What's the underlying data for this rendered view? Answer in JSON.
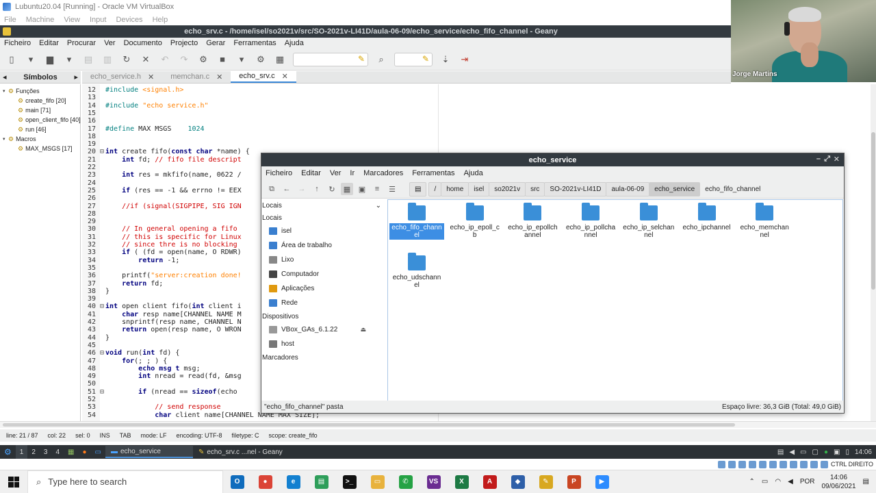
{
  "vbox": {
    "title": "Lubuntu20.04 [Running] - Oracle VM VirtualBox",
    "menu": [
      "File",
      "Machine",
      "View",
      "Input",
      "Devices",
      "Help"
    ]
  },
  "geany": {
    "title": "echo_srv.c - /home/isel/so2021v/src/SO-2021v-LI41D/aula-06-09/echo_service/echo_fifo_channel - Geany",
    "menu": [
      "Ficheiro",
      "Editar",
      "Procurar",
      "Ver",
      "Documento",
      "Projecto",
      "Gerar",
      "Ferramentas",
      "Ajuda"
    ],
    "sidebar_tab": "Símbolos",
    "symbols": [
      {
        "label": "Funções",
        "level": 0,
        "icon": "folder-icon"
      },
      {
        "label": "create_fifo [20]",
        "level": 1,
        "icon": "function-icon"
      },
      {
        "label": "main [71]",
        "level": 1,
        "icon": "function-icon"
      },
      {
        "label": "open_client_fifo [40]",
        "level": 1,
        "icon": "function-icon"
      },
      {
        "label": "run [46]",
        "level": 1,
        "icon": "function-icon"
      },
      {
        "label": "Macros",
        "level": 0,
        "icon": "folder-icon"
      },
      {
        "label": "MAX_MSGS [17]",
        "level": 1,
        "icon": "macro-icon"
      }
    ],
    "tabs": [
      {
        "label": "echo_service.h",
        "active": false
      },
      {
        "label": "memchan.c",
        "active": false
      },
      {
        "label": "echo_srv.c",
        "active": true
      }
    ],
    "status": {
      "line": "line: 21 / 87",
      "col": "col: 22",
      "sel": "sel: 0",
      "ins": "INS",
      "tab": "TAB",
      "mode": "mode: LF",
      "encoding": "encoding: UTF-8",
      "filetype": "filetype: C",
      "scope": "scope: create_fifo"
    }
  },
  "code_lines": [
    {
      "n": "12",
      "fold": "",
      "html": "<span class='pp'>#include </span><span class='str'>&lt;signal.h&gt;</span>"
    },
    {
      "n": "13",
      "fold": "",
      "html": ""
    },
    {
      "n": "14",
      "fold": "",
      "html": "<span class='pp'>#include </span><span class='str'>\"echo service.h\"</span>"
    },
    {
      "n": "15",
      "fold": "",
      "html": ""
    },
    {
      "n": "16",
      "fold": "",
      "html": ""
    },
    {
      "n": "17",
      "fold": "",
      "html": "<span class='pp'>#define</span> MAX MSGS    <span class='pp'>1024</span>"
    },
    {
      "n": "18",
      "fold": "",
      "html": ""
    },
    {
      "n": "19",
      "fold": "",
      "html": ""
    },
    {
      "n": "20",
      "fold": "⊟",
      "html": "<span class='kw'>int</span> create fifo(<span class='kw'>const char</span> *name) {"
    },
    {
      "n": "21",
      "fold": "",
      "html": "    <span class='kw'>int</span> fd; <span class='cm'>// fifo file descript</span>"
    },
    {
      "n": "22",
      "fold": "",
      "html": ""
    },
    {
      "n": "23",
      "fold": "",
      "html": "    <span class='kw'>int</span> res = mkfifo(name, 0622 /"
    },
    {
      "n": "24",
      "fold": "",
      "html": ""
    },
    {
      "n": "25",
      "fold": "",
      "html": "    <span class='kw'>if</span> (res == -1 &amp;&amp; errno != EEX"
    },
    {
      "n": "26",
      "fold": "",
      "html": ""
    },
    {
      "n": "27",
      "fold": "",
      "html": "    <span class='cm'>//if (signal(SIGPIPE, SIG IGN</span>"
    },
    {
      "n": "28",
      "fold": "",
      "html": ""
    },
    {
      "n": "29",
      "fold": "",
      "html": ""
    },
    {
      "n": "30",
      "fold": "",
      "html": "    <span class='cm'>// In general opening a fifo</span>"
    },
    {
      "n": "31",
      "fold": "",
      "html": "    <span class='cm'>// this is specific for Linux</span>"
    },
    {
      "n": "32",
      "fold": "",
      "html": "    <span class='cm'>// since thre is no blocking</span>"
    },
    {
      "n": "33",
      "fold": "",
      "html": "    <span class='kw'>if</span> ( (fd = open(name, O RDWR)"
    },
    {
      "n": "34",
      "fold": "",
      "html": "        <span class='kw'>return</span> -1;"
    },
    {
      "n": "35",
      "fold": "",
      "html": ""
    },
    {
      "n": "36",
      "fold": "",
      "html": "    printf(<span class='str'>\"server:creation done!</span>"
    },
    {
      "n": "37",
      "fold": "",
      "html": "    <span class='kw'>return</span> fd;"
    },
    {
      "n": "38",
      "fold": "",
      "html": "}"
    },
    {
      "n": "39",
      "fold": "",
      "html": ""
    },
    {
      "n": "40",
      "fold": "⊟",
      "html": "<span class='kw'>int</span> open client fifo(<span class='kw'>int</span> client i"
    },
    {
      "n": "41",
      "fold": "",
      "html": "    <span class='kw'>char</span> resp name[CHANNEL NAME M"
    },
    {
      "n": "42",
      "fold": "",
      "html": "    snprintf(resp name, CHANNEL N"
    },
    {
      "n": "43",
      "fold": "",
      "html": "    <span class='kw'>return</span> open(resp name, O WRON"
    },
    {
      "n": "44",
      "fold": "",
      "html": "}"
    },
    {
      "n": "45",
      "fold": "",
      "html": ""
    },
    {
      "n": "46",
      "fold": "⊟",
      "html": "<span class='kw'>void</span> run(<span class='kw'>int</span> fd) {"
    },
    {
      "n": "47",
      "fold": "",
      "html": "    <span class='kw'>for</span>(; ; ) {"
    },
    {
      "n": "48",
      "fold": "",
      "html": "        <span class='kw'>echo msg t</span> msg;"
    },
    {
      "n": "49",
      "fold": "",
      "html": "        <span class='kw'>int</span> nread = read(fd, &amp;msg"
    },
    {
      "n": "50",
      "fold": "",
      "html": ""
    },
    {
      "n": "51",
      "fold": "⊟",
      "html": "        <span class='kw'>if</span> (nread == <span class='kw'>sizeof</span>(echo"
    },
    {
      "n": "52",
      "fold": "",
      "html": ""
    },
    {
      "n": "53",
      "fold": "",
      "html": "            <span class='cm'>// send response</span>"
    },
    {
      "n": "54",
      "fold": "",
      "html": "            <span class='kw'>char</span> client name[CHANNEL NAME MAX SIZE];"
    }
  ],
  "fm": {
    "title": "echo_service",
    "menu": [
      "Ficheiro",
      "Editar",
      "Ver",
      "Ir",
      "Marcadores",
      "Ferramentas",
      "Ajuda"
    ],
    "path": [
      "/",
      "home",
      "isel",
      "so2021v",
      "src",
      "SO-2021v-LI41D",
      "aula-06-09",
      "echo_service",
      "echo_fifo_channel"
    ],
    "side_combo": "Locais",
    "sections": [
      {
        "title": "Locais",
        "items": [
          {
            "label": "isel",
            "icon": "home-folder-icon",
            "color": "#3a7fcf"
          },
          {
            "label": "Área de trabalho",
            "icon": "desktop-icon",
            "color": "#3a7fcf"
          },
          {
            "label": "Lixo",
            "icon": "trash-icon",
            "color": "#888"
          },
          {
            "label": "Computador",
            "icon": "computer-icon",
            "color": "#444"
          },
          {
            "label": "Aplicações",
            "icon": "applications-icon",
            "color": "#e09a10"
          },
          {
            "label": "Rede",
            "icon": "network-icon",
            "color": "#3a7fcf"
          }
        ]
      },
      {
        "title": "Dispositivos",
        "items": [
          {
            "label": "VBox_GAs_6.1.22",
            "icon": "disc-icon",
            "color": "#999",
            "eject": true
          },
          {
            "label": "host",
            "icon": "drive-icon",
            "color": "#777"
          }
        ]
      },
      {
        "title": "Marcadores",
        "items": []
      }
    ],
    "folders": [
      {
        "name": "echo_fifo_channel",
        "selected": true
      },
      {
        "name": "echo_ip_epoll_cb",
        "selected": false
      },
      {
        "name": "echo_ip_epollchannel",
        "selected": false
      },
      {
        "name": "echo_ip_pollchannel",
        "selected": false
      },
      {
        "name": "echo_ip_selchannel",
        "selected": false
      },
      {
        "name": "echo_ipchannel",
        "selected": false
      },
      {
        "name": "echo_memchannel",
        "selected": false
      },
      {
        "name": "echo_udschannel",
        "selected": false
      }
    ],
    "status_left": "\"echo_fifo_channel\" pasta",
    "status_right": "Espaço livre: 36,3 GiB (Total: 49,0 GiB)"
  },
  "lx_panel": {
    "desktops": [
      "1",
      "2",
      "3",
      "4"
    ],
    "tasks": [
      {
        "label": "echo_service",
        "active": true
      },
      {
        "label": "echo_srv.c ...nel - Geany",
        "active": false
      }
    ],
    "clock": "14:06"
  },
  "vbox_status": {
    "hostkey": "CTRL DIREITO"
  },
  "windows": {
    "search_placeholder": "Type here to search",
    "apps": [
      {
        "name": "outlook",
        "color": "#0f6cbd",
        "glyph": "O"
      },
      {
        "name": "chrome",
        "color": "#db4437",
        "glyph": "●"
      },
      {
        "name": "edge",
        "color": "#1380d0",
        "glyph": "e"
      },
      {
        "name": "sheets",
        "color": "#2e9e5a",
        "glyph": "▤"
      },
      {
        "name": "terminal",
        "color": "#111",
        "glyph": ">_"
      },
      {
        "name": "explorer",
        "color": "#e8b23c",
        "glyph": "▭"
      },
      {
        "name": "whatsapp",
        "color": "#25a244",
        "glyph": "✆"
      },
      {
        "name": "visual-studio",
        "color": "#6a2c91",
        "glyph": "VS"
      },
      {
        "name": "excel",
        "color": "#1d7a44",
        "glyph": "X"
      },
      {
        "name": "acrobat",
        "color": "#c21b1b",
        "glyph": "A"
      },
      {
        "name": "virtualbox",
        "color": "#2e5fa8",
        "glyph": "◆"
      },
      {
        "name": "sticky",
        "color": "#d8a820",
        "glyph": "✎"
      },
      {
        "name": "powerpoint",
        "color": "#c94522",
        "glyph": "P"
      },
      {
        "name": "zoom",
        "color": "#2d8cff",
        "glyph": "▶"
      }
    ],
    "lang": "POR",
    "time": "14:06",
    "date": "09/06/2021"
  },
  "webcam": {
    "name": "Jorge Martins"
  }
}
